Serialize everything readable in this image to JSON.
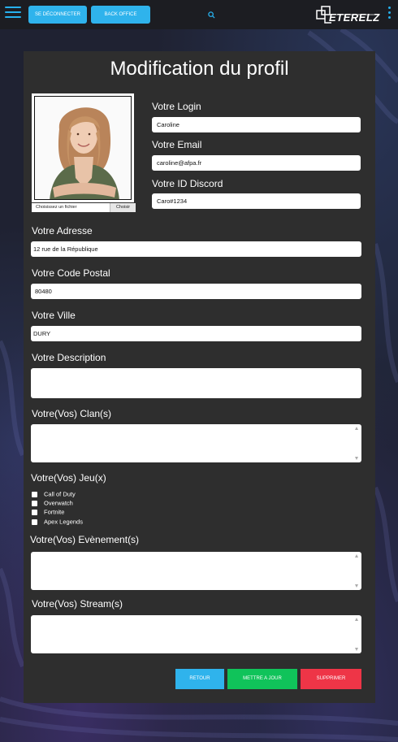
{
  "header": {
    "logout_label": "SE DÉCONNECTER",
    "backoffice_label": "BACK OFFICE",
    "logo_text": "ETERELZ"
  },
  "profile": {
    "title": "Modification du profil",
    "file_input": {
      "placeholder": "Choisissez un fichier",
      "button_label": "Choisir"
    },
    "login": {
      "label": "Votre Login",
      "value": "Caroline"
    },
    "email": {
      "label": "Votre Email",
      "value": "caroline@afpa.fr"
    },
    "discord": {
      "label": "Votre ID Discord",
      "value": "Caro#1234"
    },
    "address": {
      "label": "Votre Adresse",
      "value": "12 rue de la République"
    },
    "postal_code": {
      "label": "Votre Code Postal",
      "value": "80480"
    },
    "city": {
      "label": "Votre Ville",
      "value": "DURY"
    },
    "description": {
      "label": "Votre Description",
      "value": ""
    },
    "clans": {
      "label": "Votre(Vos) Clan(s)"
    },
    "games": {
      "label": "Votre(Vos) Jeu(x)",
      "items": [
        "Call of Duty",
        "Overwatch",
        "Fortnite",
        "Apex Legends"
      ]
    },
    "events": {
      "label": "Votre(Vos) Evènement(s)"
    },
    "streams": {
      "label": "Votre(Vos) Stream(s)"
    }
  },
  "actions": {
    "back_label": "RETOUR",
    "update_label": "METTRE A JOUR",
    "delete_label": "SUPPRIMER"
  },
  "colors": {
    "accent": "#2fb3ec",
    "update": "#10c35a",
    "delete": "#ee3547",
    "card": "#2e2e2e"
  }
}
